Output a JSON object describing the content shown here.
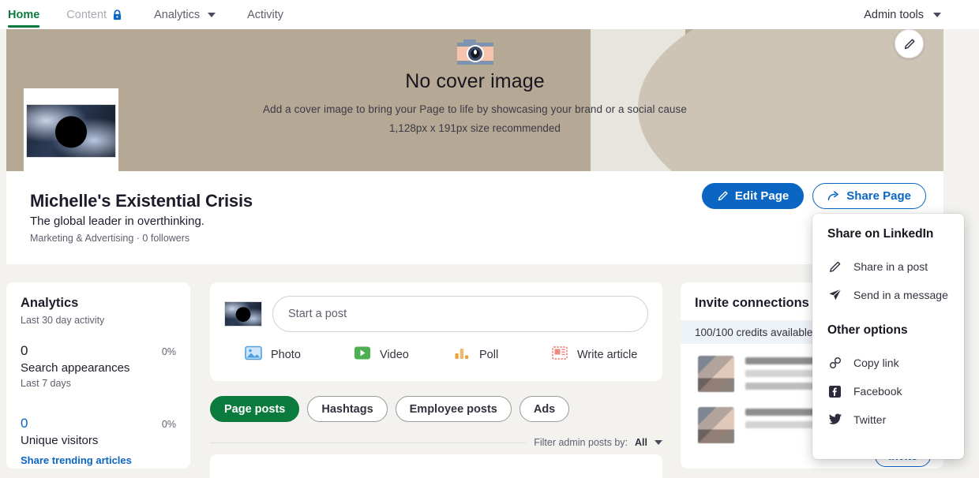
{
  "nav": {
    "items": [
      {
        "label": "Home",
        "icon": "",
        "active": true
      },
      {
        "label": "Content",
        "icon": "lock-icon",
        "active": false
      },
      {
        "label": "Analytics",
        "icon": "chevron-down-icon",
        "active": false
      },
      {
        "label": "Activity",
        "icon": "",
        "active": false
      }
    ],
    "admin_tools": "Admin tools"
  },
  "cover": {
    "icon": "camera-icon",
    "title": "No cover image",
    "subtitle": "Add a cover image to bring your Page to life by showcasing your brand or a social cause",
    "size_hint": "1,128px x 191px size recommended",
    "edit_icon": "pencil-icon",
    "bg_dark": "#b5a894",
    "bg_light": "#cdc4b6",
    "bg_strip": "#e8e5de"
  },
  "profile": {
    "name": "Michelle's Existential Crisis",
    "tagline": "The global leader in overthinking.",
    "meta": "Marketing & Advertising · 0 followers",
    "avatar": "black-hole-avatar",
    "edit_button": "Edit Page",
    "edit_icon": "pencil-icon",
    "share_button": "Share Page",
    "share_icon": "share-arrow-icon",
    "accent": "#0a66c2"
  },
  "share_menu": {
    "section_one": "Share on LinkedIn",
    "items_one": [
      {
        "label": "Share in a post",
        "icon": "pencil-icon"
      },
      {
        "label": "Send in a message",
        "icon": "paper-plane-icon"
      }
    ],
    "section_two": "Other options",
    "items_two": [
      {
        "label": "Copy link",
        "icon": "link-icon"
      },
      {
        "label": "Facebook",
        "icon": "facebook-icon"
      },
      {
        "label": "Twitter",
        "icon": "twitter-icon"
      }
    ]
  },
  "analytics": {
    "title": "Analytics",
    "subtitle": "Last 30 day activity",
    "stat1_value": "0",
    "stat1_pct": "0%",
    "stat1_label": "Search appearances",
    "stat1_note": "Last 7 days",
    "stat2_value": "0",
    "stat2_pct": "0%",
    "stat2_label": "Unique visitors",
    "link": "Share trending articles"
  },
  "composer": {
    "placeholder": "Start a post",
    "avatar": "black-hole-avatar",
    "actions": [
      {
        "label": "Photo",
        "icon": "photo-icon",
        "color": "#4f9fe0"
      },
      {
        "label": "Video",
        "icon": "video-icon",
        "color": "#4caf50"
      },
      {
        "label": "Poll",
        "icon": "poll-icon",
        "color": "#e8a33d"
      },
      {
        "label": "Write article",
        "icon": "article-icon",
        "color": "#e8756b"
      }
    ]
  },
  "feed_filters": {
    "chips": [
      {
        "label": "Page posts",
        "selected": true
      },
      {
        "label": "Hashtags",
        "selected": false
      },
      {
        "label": "Employee posts",
        "selected": false
      },
      {
        "label": "Ads",
        "selected": false
      }
    ],
    "filter_label": "Filter admin posts by:",
    "filter_value": "All",
    "selected_color": "#0a7a3d"
  },
  "invite": {
    "title": "Invite connections",
    "credits": "100/100 credits available",
    "invite_button": "Invite"
  }
}
